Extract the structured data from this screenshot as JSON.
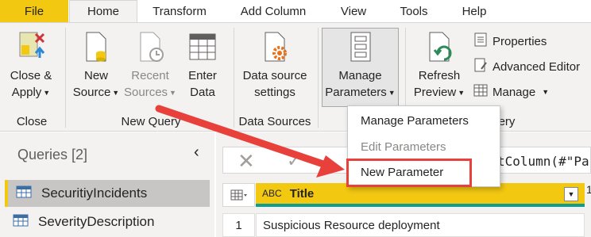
{
  "tabs": {
    "file": "File",
    "home": "Home",
    "transform": "Transform",
    "add_column": "Add Column",
    "view": "View",
    "tools": "Tools",
    "help": "Help"
  },
  "ribbon": {
    "close_apply": [
      "Close &",
      "Apply"
    ],
    "new_source": [
      "New",
      "Source"
    ],
    "recent_sources": [
      "Recent",
      "Sources"
    ],
    "enter_data": [
      "Enter",
      "Data"
    ],
    "data_source_settings": [
      "Data source",
      "settings"
    ],
    "manage_parameters": [
      "Manage",
      "Parameters"
    ],
    "refresh_preview": [
      "Refresh",
      "Preview"
    ],
    "properties": "Properties",
    "advanced_editor": "Advanced Editor",
    "manage": "Manage",
    "groups": {
      "close": "Close",
      "new_query": "New Query",
      "data_sources": "Data Sources",
      "query_partial": "ery"
    }
  },
  "dropdown": {
    "items": [
      "Manage Parameters",
      "Edit Parameters",
      "New Parameter"
    ],
    "highlighted": "New Parameter"
  },
  "queries": {
    "title": "Queries [2]",
    "items": [
      "SecuritiyIncidents",
      "SeverityDescription"
    ],
    "selected": "SecuritiyIncidents"
  },
  "formula_bar": {
    "text": "tColumn(#\"Pa"
  },
  "grid": {
    "column_type": "ABC",
    "column_title": "Title",
    "next_column_partial": "1",
    "rows": [
      {
        "num": "1",
        "title": "Suspicious Resource deployment"
      }
    ]
  },
  "colors": {
    "accent_yellow": "#f2c811",
    "highlight_red": "#e8403a",
    "teal": "#0e9e8f"
  }
}
